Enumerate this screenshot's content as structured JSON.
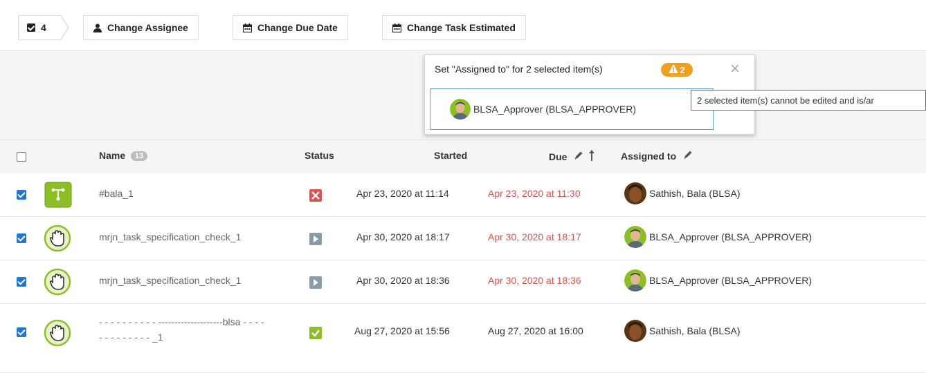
{
  "toolbar": {
    "selected_count": "4",
    "change_assignee": "Change Assignee",
    "change_due_date": "Change Due Date",
    "change_task_estimated": "Change Task Estimated"
  },
  "popup": {
    "title": "Set \"Assigned to\" for 2 selected item(s)",
    "warning_count": "2",
    "close": "×",
    "value": "BLSA_Approver (BLSA_APPROVER)"
  },
  "tooltip": "2 selected item(s) cannot be edited and is/ar",
  "table": {
    "headers": {
      "name": "Name",
      "name_count": "13",
      "status": "Status",
      "started": "Started",
      "due": "Due",
      "assigned_to": "Assigned to"
    },
    "rows": [
      {
        "name": "#bala_1",
        "name2": "",
        "status": "rejected",
        "started": "Apr 23, 2020 at 11:14",
        "due": "Apr 23, 2020 at 11:30",
        "due_overdue": true,
        "assigned": "Sathish, Bala (BLSA)",
        "icon": "workflow-icon"
      },
      {
        "name": "mrjn_task_specification_check_1",
        "name2": "",
        "status": "in-progress",
        "started": "Apr 30, 2020 at 18:17",
        "due": "Apr 30, 2020 at 18:17",
        "due_overdue": true,
        "assigned": "BLSA_Approver (BLSA_APPROVER)",
        "icon": "hand-icon"
      },
      {
        "name": "mrjn_task_specification_check_1",
        "name2": "",
        "status": "in-progress",
        "started": "Apr 30, 2020 at 18:36",
        "due": "Apr 30, 2020 at 18:36",
        "due_overdue": true,
        "assigned": "BLSA_Approver (BLSA_APPROVER)",
        "icon": "hand-icon"
      },
      {
        "name": "- - - - - - - - - - --------------------blsa - - - -",
        "name2": "- - - - - - - - - _1",
        "status": "completed",
        "started": "Aug 27, 2020 at 15:56",
        "due": "Aug 27, 2020 at 16:00",
        "due_overdue": false,
        "assigned": "Sathish, Bala (BLSA)",
        "icon": "hand-icon"
      }
    ]
  },
  "colors": {
    "overdue": "#d9534f",
    "accent": "#2176d2",
    "warning": "#f0a020",
    "task_green": "#8cbf26"
  }
}
